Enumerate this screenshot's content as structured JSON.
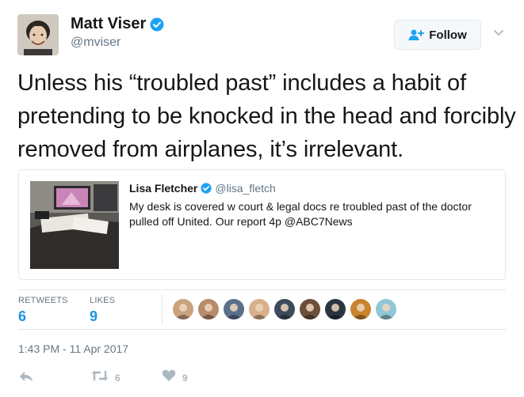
{
  "author": {
    "name": "Matt Viser",
    "handle": "@mviser",
    "verified": true
  },
  "follow_button": {
    "label": "Follow",
    "icon": "add-user-icon"
  },
  "tweet_text": "Unless his “troubled past” includes a habit of pretending to be knocked in the head and forcibly removed from airplanes, it’s irrelevant.",
  "quoted_tweet": {
    "name": "Lisa Fletcher",
    "handle": "@lisa_fletch",
    "verified": true,
    "text": "My desk is covered w court & legal docs re troubled past of the doctor pulled off United.  Our report 4p @ABC7News"
  },
  "stats": {
    "retweets_label": "RETWEETS",
    "retweets": "6",
    "likes_label": "LIKES",
    "likes": "9"
  },
  "liker_avatars": [
    {
      "color": "#c9a27e"
    },
    {
      "color": "#b68a6a"
    },
    {
      "color": "#5a6f8a"
    },
    {
      "color": "#d8b08c"
    },
    {
      "color": "#3c4a5c"
    },
    {
      "color": "#6b4f3a"
    },
    {
      "color": "#2c3440"
    },
    {
      "color": "#c8842e"
    },
    {
      "color": "#8fc7d6"
    }
  ],
  "timestamp": "1:43 PM - 11 Apr 2017",
  "actions": {
    "reply_icon": "reply-icon",
    "retweet_icon": "retweet-icon",
    "retweet_count": "6",
    "like_icon": "heart-icon",
    "like_count": "9"
  },
  "colors": {
    "verified": "#1da1f2",
    "link_blue": "#1b95e0",
    "muted": "#657786",
    "action_gray": "#aab8c2"
  }
}
